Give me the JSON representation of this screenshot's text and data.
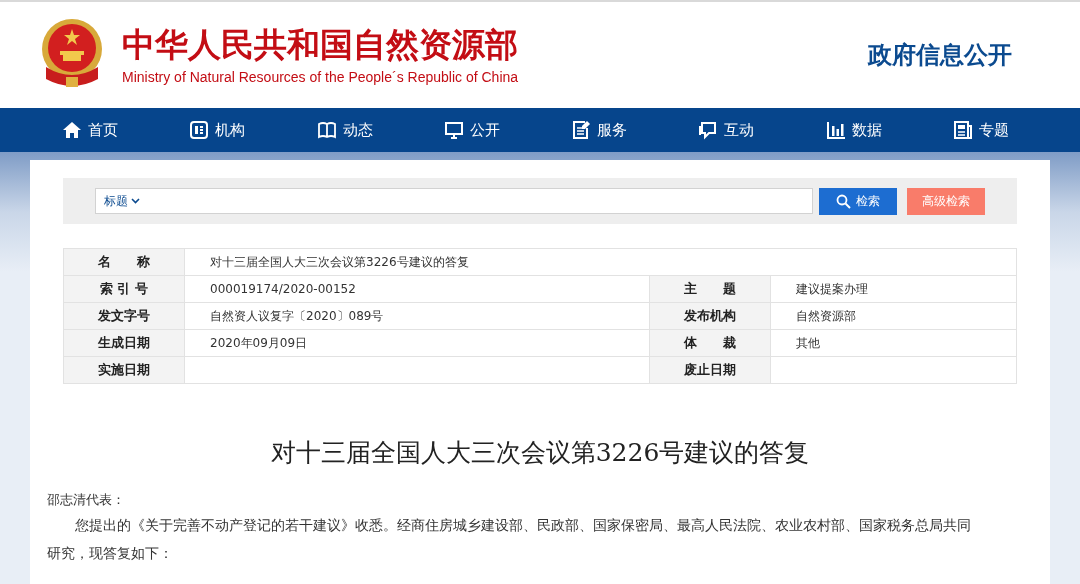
{
  "header": {
    "title": "中华人民共和国自然资源部",
    "subtitle": "Ministry of Natural Resources of the People´s Republic of China",
    "section": "政府信息公开"
  },
  "nav": [
    {
      "kind": "home",
      "label": "首页"
    },
    {
      "kind": "org",
      "label": "机构"
    },
    {
      "kind": "book",
      "label": "动态"
    },
    {
      "kind": "screen",
      "label": "公开"
    },
    {
      "kind": "doc",
      "label": "服务"
    },
    {
      "kind": "chat",
      "label": "互动"
    },
    {
      "kind": "chart",
      "label": "数据"
    },
    {
      "kind": "topic",
      "label": "专题"
    }
  ],
  "search": {
    "scope": "标题",
    "button": "检索",
    "advanced": "高级检索"
  },
  "meta": [
    {
      "label": "名　　称",
      "value": "对十三届全国人大三次会议第3226号建议的答复"
    },
    {
      "label": "索 引 号",
      "value": "000019174/2020-00152",
      "label2": "主　　题",
      "value2": "建议提案办理"
    },
    {
      "label": "发文字号",
      "value": "自然资人议复字〔2020〕089号",
      "label2": "发布机构",
      "value2": "自然资源部"
    },
    {
      "label": "生成日期",
      "value": "2020年09月09日",
      "label2": "体　　裁",
      "value2": "其他"
    },
    {
      "label": "实施日期",
      "label2": "废止日期"
    }
  ],
  "article": {
    "title": "对十三届全国人大三次会议第3226号建议的答复",
    "salutation": "邵志清代表：",
    "paragraphs": [
      "您提出的《关于完善不动产登记的若干建议》收悉。经商住房城乡建设部、民政部、国家保密局、最高人民法院、农业农村部、国家税务总局共同研究，现答复如下："
    ]
  }
}
